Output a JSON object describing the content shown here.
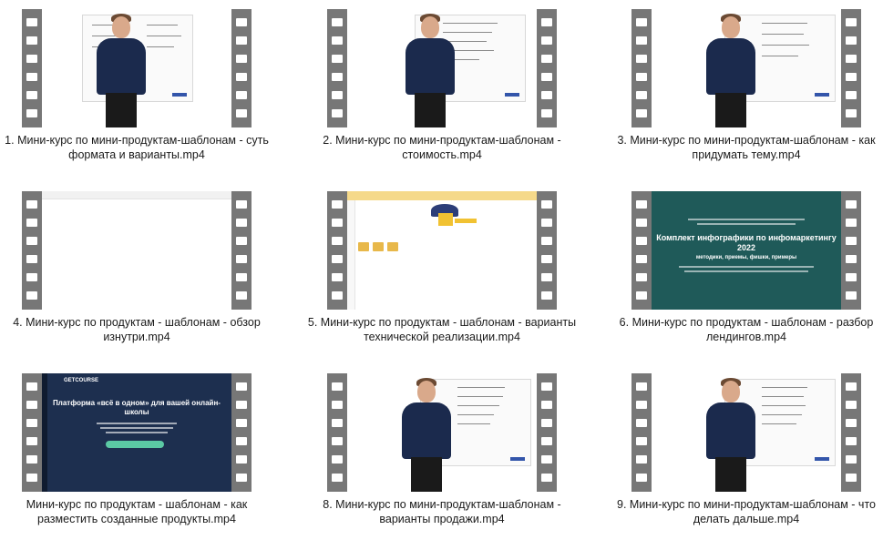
{
  "videos": [
    {
      "label": "1. Мини-курс по мини-продуктам-шаблонам - суть формата и варианты.mp4",
      "frame": "whiteboard"
    },
    {
      "label": "2. Мини-курс по мини-продуктам-шаблонам - стоимость.mp4",
      "frame": "whiteboard"
    },
    {
      "label": "3. Мини-курс по мини-продуктам-шаблонам - как придумать тему.mp4",
      "frame": "whiteboard"
    },
    {
      "label": "4. Мини-курс по продуктам - шаблонам - обзор изнутри.mp4",
      "frame": "blank-screen"
    },
    {
      "label": "5. Мини-курс по продуктам - шаблонам - варианты технической реализации.mp4",
      "frame": "app-screen"
    },
    {
      "label": "6. Мини-курс по продуктам - шаблонам - разбор лендингов.mp4",
      "frame": "landing",
      "screen_title": "Комплект инфографики по инфомаркетингу 2022",
      "screen_subtitle": "методики, приемы, фишки, примеры"
    },
    {
      "label": "Мини-курс по продуктам - шаблонам - как разместить созданные продукты.mp4",
      "frame": "getcourse",
      "logo": "GETCOURSE",
      "screen_title": "Платформа «всё в одном» для вашей онлайн-школы"
    },
    {
      "label": "8. Мини-курс по мини-продуктам-шаблонам - варианты продажи.mp4",
      "frame": "whiteboard"
    },
    {
      "label": "9. Мини-курс по мини-продуктам-шаблонам - что делать дальше.mp4",
      "frame": "whiteboard"
    }
  ],
  "colors": {
    "film": "#777777",
    "landing_bg": "#1f5a59",
    "getcourse_bg": "#1d2f4f",
    "accent": "#5bc9a4"
  }
}
